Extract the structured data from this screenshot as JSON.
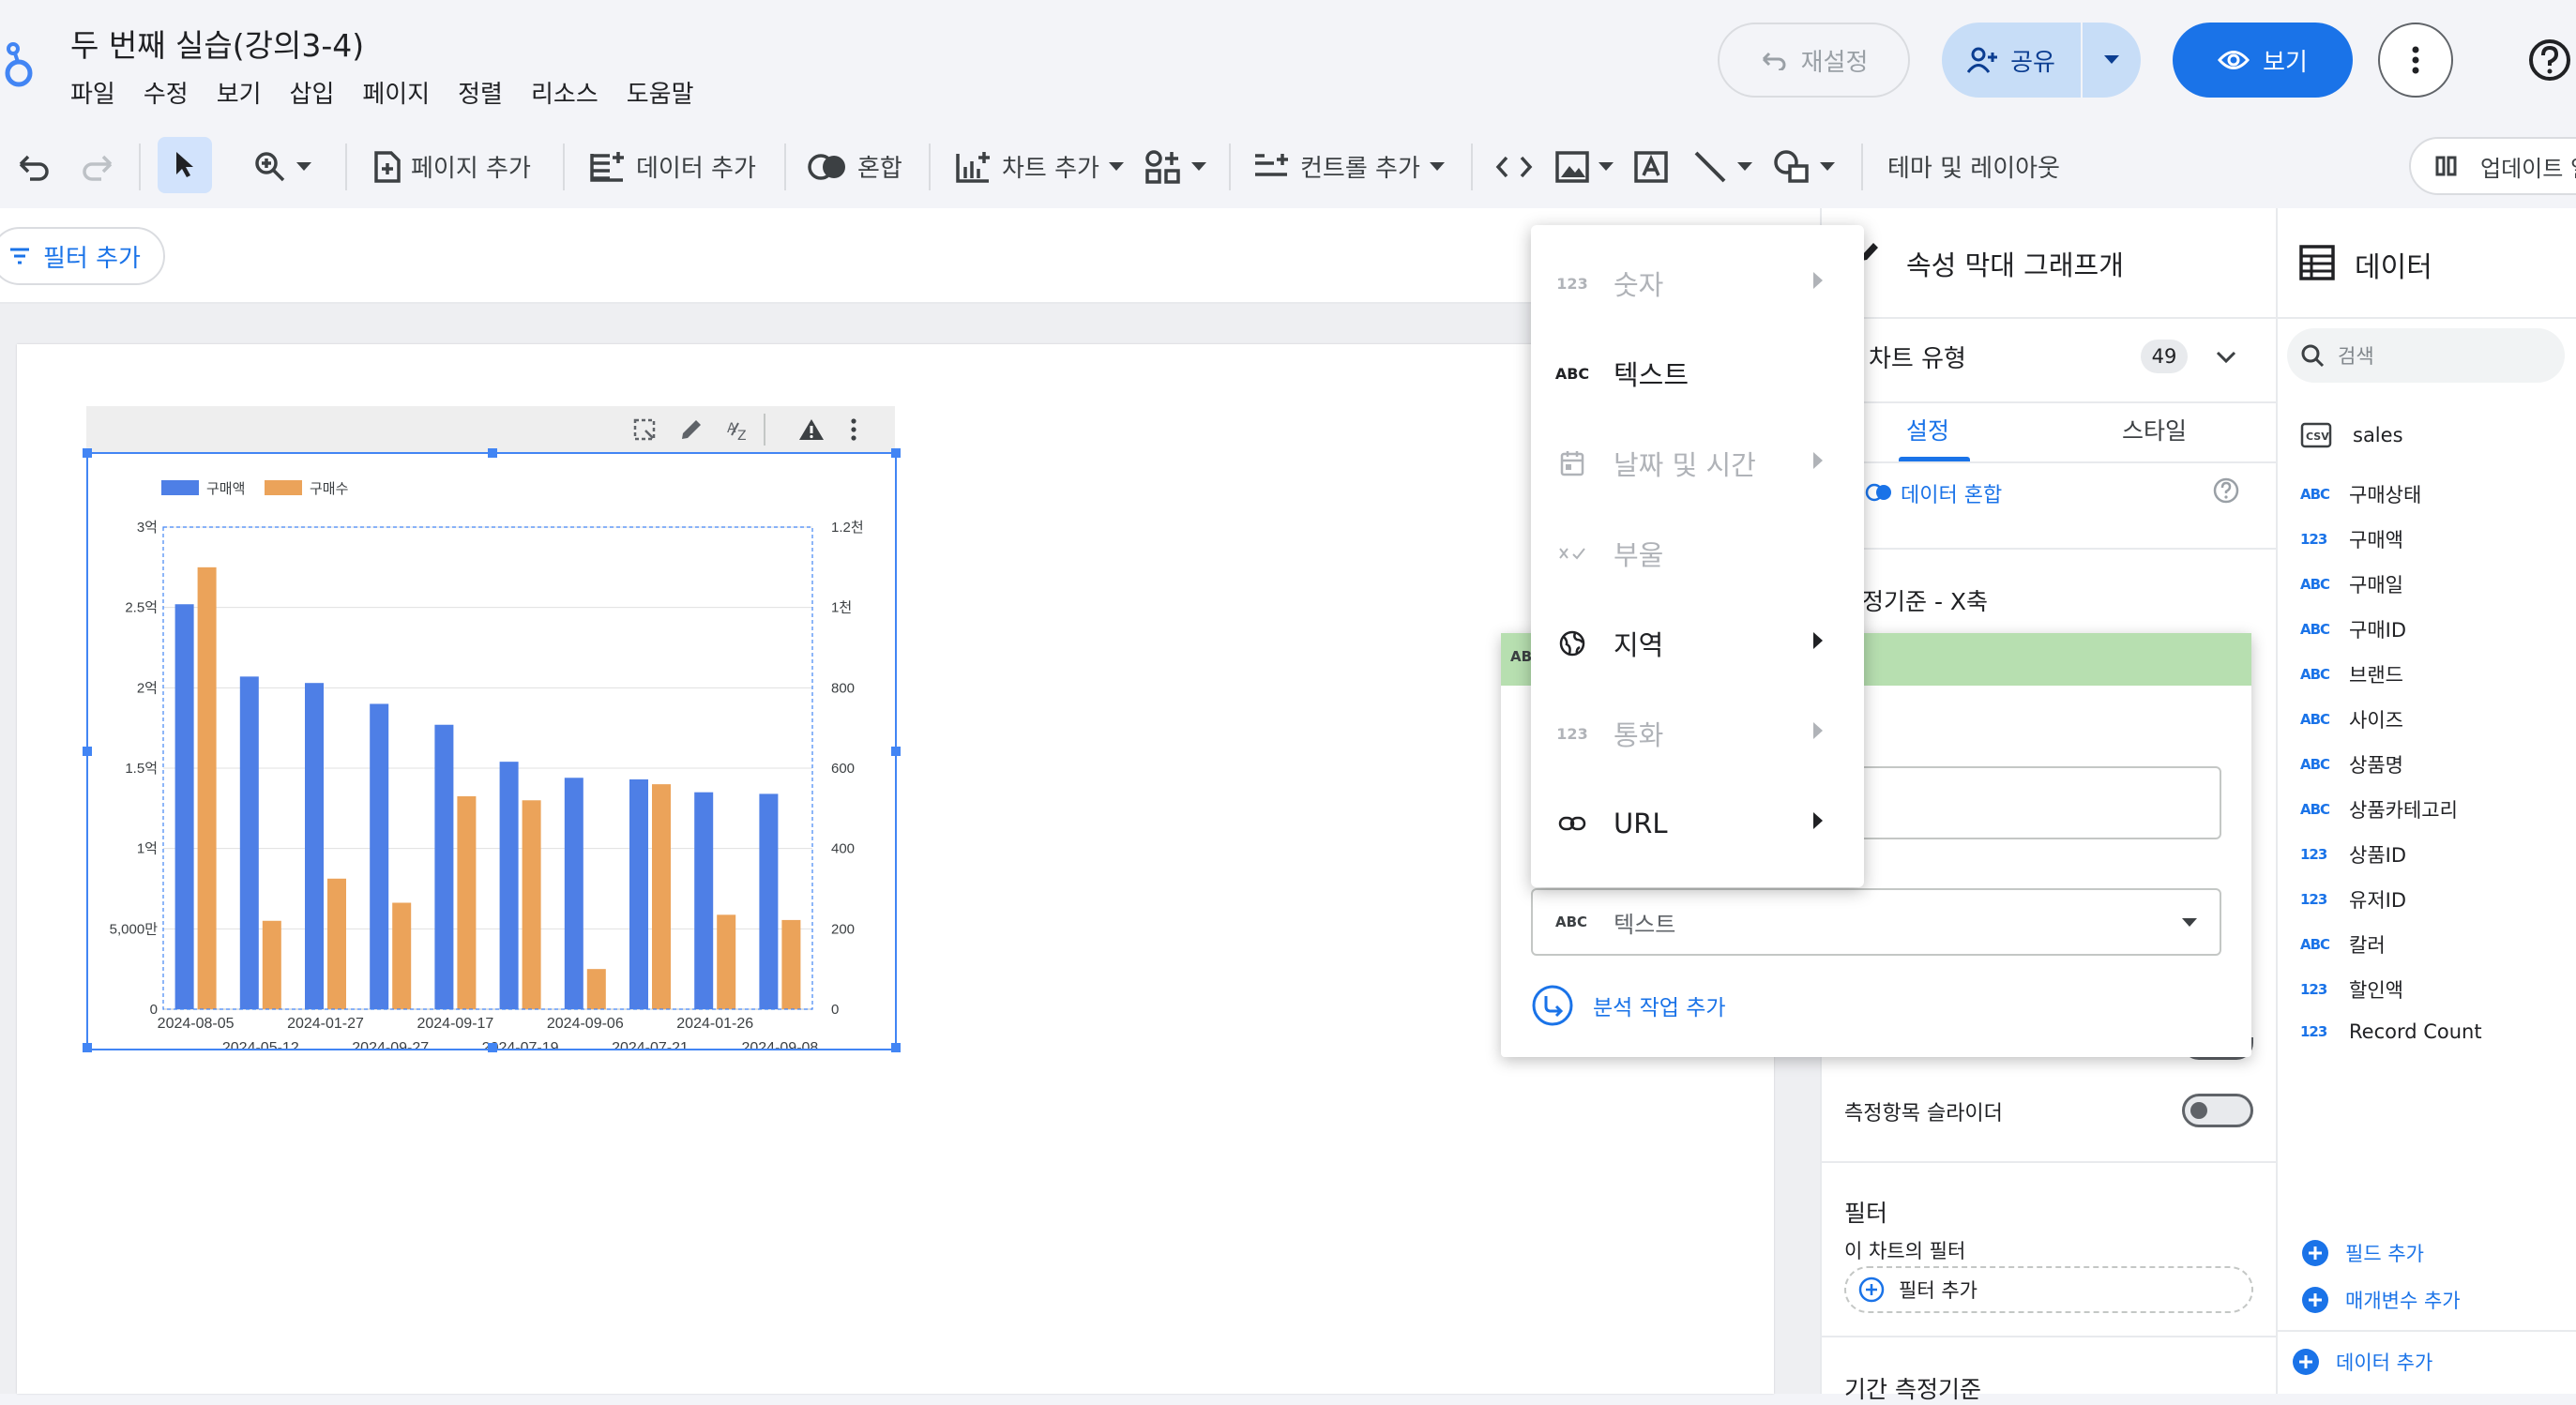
{
  "header": {
    "doc_title": "두 번째 실습(강의3-4)",
    "menu": [
      "파일",
      "수정",
      "보기",
      "삽입",
      "페이지",
      "정렬",
      "리소스",
      "도움말"
    ],
    "reset_label": "재설정",
    "share_label": "공유",
    "view_label": "보기"
  },
  "toolbar": {
    "add_page": "페이지 추가",
    "add_data": "데이터 추가",
    "blend": "혼합",
    "add_chart": "차트 추가",
    "add_control": "컨트롤 추가",
    "theme_layout": "테마 및 레이아웃",
    "update": "업데이트 일"
  },
  "filter_bar": {
    "add_filter": "필터 추가"
  },
  "chart_data": {
    "type": "bar",
    "categories": [
      "2024-08-05",
      "2024-05-12",
      "2024-01-27",
      "2024-09-27",
      "2024-09-17",
      "2024-07-19",
      "2024-09-06",
      "2024-07-21",
      "2024-01-26",
      "2024-09-08"
    ],
    "series": [
      {
        "name": "구매액",
        "axis": "left",
        "color": "#4e7fe6",
        "values": [
          252000000,
          207000000,
          203000000,
          190000000,
          177000000,
          154000000,
          144000000,
          143000000,
          135000000,
          134000000
        ]
      },
      {
        "name": "구매수",
        "axis": "right",
        "color": "#eba35a",
        "values": [
          1100,
          220,
          325,
          265,
          530,
          520,
          100,
          560,
          235,
          222
        ]
      }
    ],
    "y_left": {
      "ticks": [
        "0",
        "5,000만",
        "1억",
        "1.5억",
        "2억",
        "2.5억",
        "3억"
      ],
      "range": [
        0,
        300000000
      ]
    },
    "y_right": {
      "ticks": [
        "0",
        "200",
        "400",
        "600",
        "800",
        "1천",
        "1.2천"
      ],
      "range": [
        0,
        1200
      ]
    },
    "legend": "top-left",
    "grid": true
  },
  "props_panel": {
    "title": "속성 막대 그래프개",
    "chart_type_label": "차트 유형",
    "chart_type_count": "49",
    "tabs": [
      "설정",
      "스타일"
    ],
    "blend_label": "데이터 혼합",
    "dimension_header": "측정기준 - X축",
    "metric_slider_label": "측정항목 슬라이더",
    "filter_header": "필터",
    "chart_filter_label": "이 차트의 필터",
    "add_filter": "필터 추가",
    "date_dim_label": "기간 측정기준"
  },
  "dim_popup": {
    "type_value": "텍스트",
    "add_analysis": "분석 작업 추가"
  },
  "type_menu": {
    "items": [
      {
        "icon": "123",
        "label": "숫자",
        "disabled": true,
        "submenu": true
      },
      {
        "icon": "ABC",
        "label": "텍스트",
        "disabled": false,
        "submenu": false
      },
      {
        "icon": "calendar",
        "label": "날짜 및 시간",
        "disabled": true,
        "submenu": true
      },
      {
        "icon": "bool",
        "label": "부울",
        "disabled": true,
        "submenu": false
      },
      {
        "icon": "globe",
        "label": "지역",
        "disabled": false,
        "submenu": true
      },
      {
        "icon": "123",
        "label": "통화",
        "disabled": true,
        "submenu": true
      },
      {
        "icon": "link",
        "label": "URL",
        "disabled": false,
        "submenu": true
      }
    ]
  },
  "data_panel": {
    "title": "데이터",
    "search_placeholder": "검색",
    "source": "sales",
    "fields": [
      {
        "type": "ABC",
        "name": "구매상태"
      },
      {
        "type": "123",
        "name": "구매액"
      },
      {
        "type": "ABC",
        "name": "구매일"
      },
      {
        "type": "ABC",
        "name": "구매ID"
      },
      {
        "type": "ABC",
        "name": "브랜드"
      },
      {
        "type": "ABC",
        "name": "사이즈"
      },
      {
        "type": "ABC",
        "name": "상품명"
      },
      {
        "type": "ABC",
        "name": "상품카테고리"
      },
      {
        "type": "123",
        "name": "상품ID"
      },
      {
        "type": "123",
        "name": "유저ID"
      },
      {
        "type": "ABC",
        "name": "칼러"
      },
      {
        "type": "123",
        "name": "할인액"
      },
      {
        "type": "123",
        "name": "Record Count"
      }
    ],
    "add_field": "필드 추가",
    "add_param": "매개변수 추가",
    "add_data": "데이터 추가"
  }
}
